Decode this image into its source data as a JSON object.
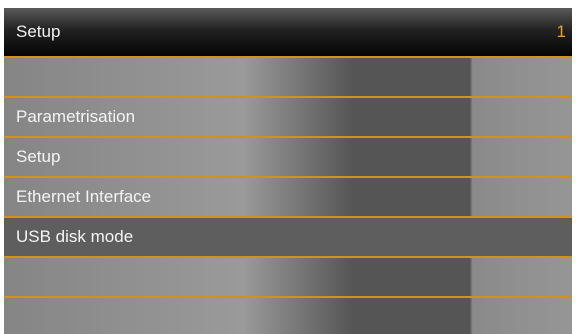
{
  "header": {
    "title": "Setup",
    "page_number": "1"
  },
  "menu": {
    "items": [
      {
        "label": ""
      },
      {
        "label": "Parametrisation"
      },
      {
        "label": "Setup"
      },
      {
        "label": "Ethernet Interface"
      },
      {
        "label": "USB disk mode",
        "selected": true
      },
      {
        "label": ""
      },
      {
        "label": ""
      }
    ]
  },
  "colors": {
    "accent": "#d4901c",
    "selected_row": "#5e5e5e",
    "page_number": "#f0a020"
  }
}
